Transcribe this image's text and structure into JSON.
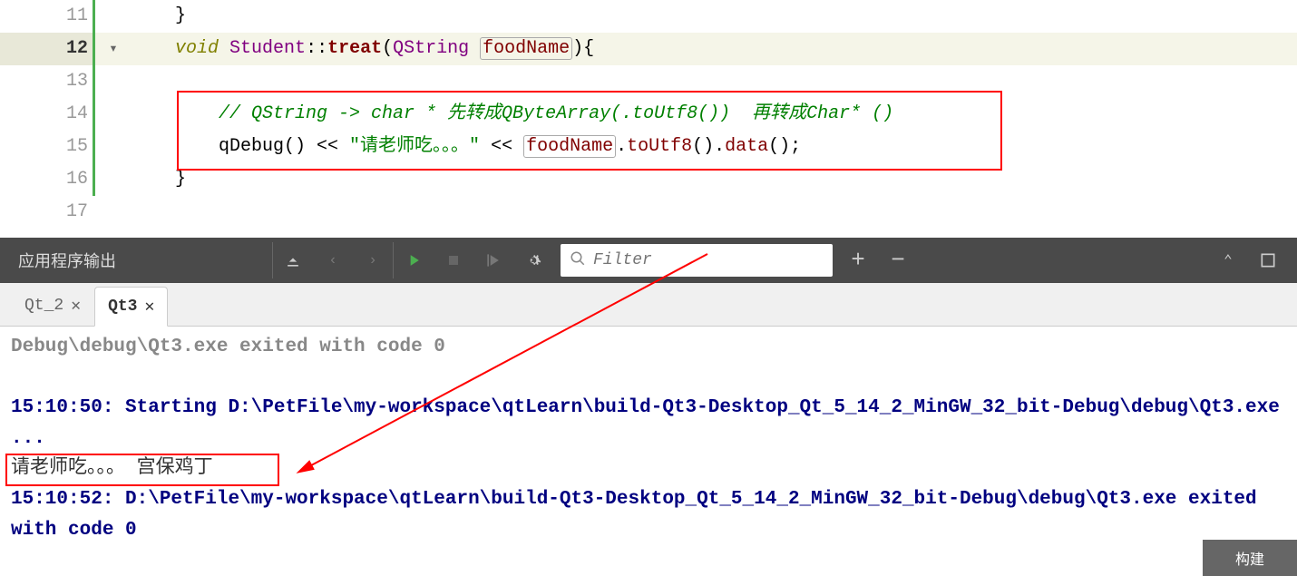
{
  "editor": {
    "lines": [
      {
        "num": "11",
        "fold": "",
        "content": "    }"
      },
      {
        "num": "12",
        "fold": "▾",
        "current": true,
        "tokens": [
          "void",
          "Student",
          "treat",
          "QString",
          "foodName"
        ]
      },
      {
        "num": "13",
        "fold": "",
        "content": ""
      },
      {
        "num": "14",
        "fold": "",
        "comment": "// QString -> char * 先转成QByteArray(.toUtf8())  再转成Char* ()"
      },
      {
        "num": "15",
        "fold": "",
        "qdebug": "qDebug",
        "str": "\"请老师吃。。。\"",
        "param": "foodName",
        "m1": "toUtf8",
        "m2": "data"
      },
      {
        "num": "16",
        "fold": "",
        "content": "    }"
      },
      {
        "num": "17",
        "fold": "",
        "content": ""
      }
    ]
  },
  "toolbar": {
    "title": "应用程序输出",
    "filter_placeholder": "Filter"
  },
  "tabs": [
    {
      "label": "Qt_2",
      "active": false
    },
    {
      "label": "Qt3",
      "active": true
    }
  ],
  "console": {
    "lines": [
      {
        "cls": "gray",
        "text": "Debug\\debug\\Qt3.exe exited with code 0"
      },
      {
        "cls": "",
        "text": " "
      },
      {
        "cls": "info",
        "text": "15:10:50: Starting D:\\PetFile\\my-workspace\\qtLearn\\build-Qt3-Desktop_Qt_5_14_2_MinGW_32_bit-Debug\\debug\\Qt3.exe ..."
      },
      {
        "cls": "plain",
        "text": "请老师吃。。。 宫保鸡丁"
      },
      {
        "cls": "info",
        "text": "15:10:52: D:\\PetFile\\my-workspace\\qtLearn\\build-Qt3-Desktop_Qt_5_14_2_MinGW_32_bit-Debug\\debug\\Qt3.exe exited with code 0"
      }
    ]
  },
  "build_btn": "构建"
}
